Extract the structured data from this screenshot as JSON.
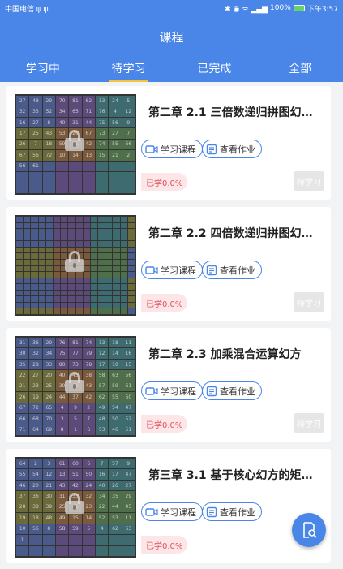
{
  "status_bar": {
    "carrier": "中国电信 ψ ψ",
    "battery": "100%",
    "time": "下午3:57"
  },
  "header": {
    "title": "课程"
  },
  "tabs": [
    {
      "label": "学习中",
      "active": false
    },
    {
      "label": "待学习",
      "active": true
    },
    {
      "label": "已完成",
      "active": false
    },
    {
      "label": "全部",
      "active": false
    }
  ],
  "courses": [
    {
      "title": "第二章  2.1 三倍数递归拼图幻…",
      "study_label": "学习课程",
      "homework_label": "查看作业",
      "progress": "已学0.0%",
      "action": "待学习",
      "thumb_size": 9,
      "thumb_numbers": [
        "27",
        "48",
        "29",
        "70",
        "81",
        "62",
        "13",
        "24",
        "5",
        "32",
        "33",
        "52",
        "34",
        "65",
        "71",
        "76",
        "4",
        "12",
        "16",
        "27",
        "8",
        "40",
        "31",
        "44",
        "75",
        "56",
        "9",
        "17",
        "25",
        "43",
        "53",
        "26",
        "67",
        "73",
        "27",
        "7",
        "26",
        "7",
        "18",
        "59",
        "51",
        "42",
        "74",
        "55",
        "66",
        "67",
        "56",
        "72",
        "10",
        "14",
        "13",
        "15",
        "21",
        "2",
        "56",
        "61"
      ]
    },
    {
      "title": "第二章  2.2 四倍数递归拼图幻…",
      "study_label": "学习课程",
      "homework_label": "查看作业",
      "progress": "已学0.0%",
      "action": "待学习",
      "thumb_size": 16,
      "thumb_numbers": []
    },
    {
      "title": "第二章  2.3 加乘混合运算幻方",
      "study_label": "学习课程",
      "homework_label": "查看作业",
      "progress": "已学0.0%",
      "action": "待学习",
      "thumb_size": 9,
      "thumb_numbers": [
        "31",
        "36",
        "29",
        "76",
        "81",
        "74",
        "13",
        "18",
        "11",
        "30",
        "32",
        "34",
        "75",
        "77",
        "79",
        "12",
        "14",
        "16",
        "35",
        "28",
        "33",
        "80",
        "73",
        "78",
        "17",
        "10",
        "15",
        "22",
        "27",
        "20",
        "40",
        "45",
        "38",
        "58",
        "63",
        "56",
        "21",
        "23",
        "25",
        "39",
        "41",
        "43",
        "57",
        "59",
        "61",
        "26",
        "19",
        "24",
        "44",
        "37",
        "42",
        "62",
        "55",
        "60",
        "67",
        "72",
        "65",
        "4",
        "9",
        "2",
        "49",
        "54",
        "47",
        "66",
        "68",
        "70",
        "3",
        "5",
        "7",
        "48",
        "50",
        "52",
        "71",
        "64",
        "69",
        "8",
        "1",
        "6",
        "53",
        "46",
        "51"
      ]
    },
    {
      "title": "第三章  3.1 基于核心幻方的矩…",
      "study_label": "学习课程",
      "homework_label": "查看作业",
      "progress": "已学0.0%",
      "action": "",
      "thumb_size": 9,
      "thumb_numbers": [
        "64",
        "2",
        "3",
        "61",
        "60",
        "6",
        "7",
        "57",
        "9",
        "55",
        "54",
        "12",
        "13",
        "51",
        "50",
        "16",
        "17",
        "47",
        "46",
        "20",
        "21",
        "43",
        "42",
        "24",
        "40",
        "26",
        "27",
        "37",
        "36",
        "30",
        "31",
        "33",
        "32",
        "34",
        "35",
        "29",
        "28",
        "38",
        "39",
        "25",
        "41",
        "23",
        "22",
        "44",
        "45",
        "19",
        "18",
        "48",
        "49",
        "15",
        "14",
        "52",
        "53",
        "11",
        "10",
        "56",
        "8",
        "58",
        "59",
        "5",
        "4",
        "62",
        "63",
        "1"
      ]
    }
  ],
  "fab": {
    "icon": "search-document-icon"
  }
}
